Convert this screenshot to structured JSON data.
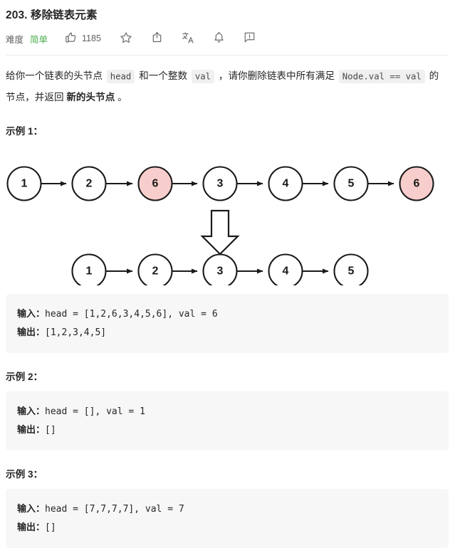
{
  "problem": {
    "title": "203. 移除链表元素",
    "difficulty_label": "难度",
    "difficulty_value": "简单",
    "difficulty_color": "#4caf50",
    "like_count": "1185"
  },
  "actions": [
    {
      "name": "thumbs-up-icon",
      "label": "1185"
    },
    {
      "name": "star-icon",
      "label": ""
    },
    {
      "name": "share-icon",
      "label": ""
    },
    {
      "name": "translate-icon",
      "label": ""
    },
    {
      "name": "bell-icon",
      "label": ""
    },
    {
      "name": "report-icon",
      "label": ""
    }
  ],
  "description": {
    "part1": "给你一个链表的头节点 ",
    "code1": "head",
    "part2": " 和一个整数 ",
    "code2": "val",
    "part3": " ，请你删除链表中所有满足 ",
    "code3": "Node.val == val",
    "part4": " 的节点，并返回 ",
    "bold1": "新的头节点",
    "part5": " 。"
  },
  "examples": [
    {
      "heading": "示例 1：",
      "input_label": "输入：",
      "input_value": "head = [1,2,6,3,4,5,6], val = 6",
      "output_label": "输出：",
      "output_value": "[1,2,3,4,5]"
    },
    {
      "heading": "示例 2：",
      "input_label": "输入：",
      "input_value": "head = [], val = 1",
      "output_label": "输出：",
      "output_value": "[]"
    },
    {
      "heading": "示例 3：",
      "input_label": "输入：",
      "input_value": "head = [7,7,7,7], val = 7",
      "output_label": "输出：",
      "output_value": "[]"
    }
  ],
  "diagram": {
    "highlight_fill": "#f8cecc",
    "node_fill": "#ffffff",
    "stroke": "#1a1a1a",
    "before_nodes": [
      "1",
      "2",
      "6",
      "3",
      "4",
      "5",
      "6"
    ],
    "before_highlighted": [
      false,
      false,
      true,
      false,
      false,
      false,
      true
    ],
    "after_nodes": [
      "1",
      "2",
      "3",
      "4",
      "5"
    ],
    "after_highlighted": [
      false,
      false,
      false,
      false,
      false
    ],
    "transition_icon": "down-arrow-icon"
  }
}
